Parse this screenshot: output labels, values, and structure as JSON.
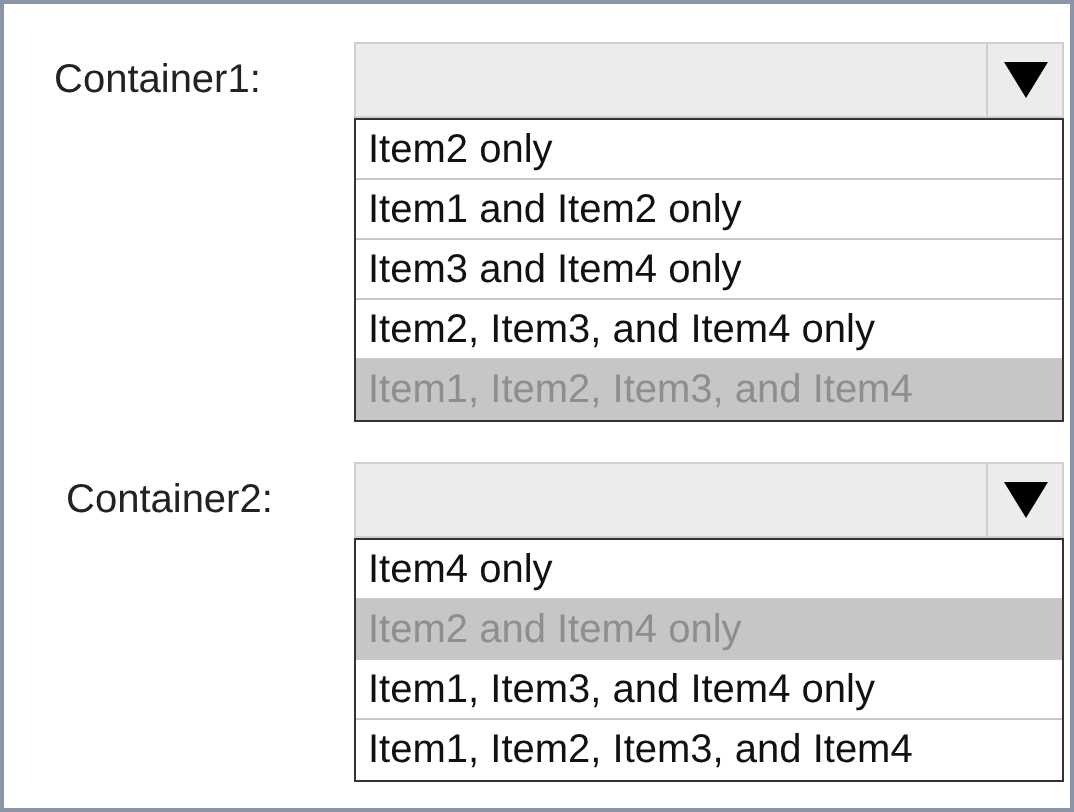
{
  "containers": [
    {
      "label": "Container1:",
      "options": [
        {
          "text": "Item2 only",
          "selected": false
        },
        {
          "text": "Item1 and Item2 only",
          "selected": false
        },
        {
          "text": "Item3 and Item4 only",
          "selected": false
        },
        {
          "text": "Item2, Item3, and Item4 only",
          "selected": false
        },
        {
          "text": "Item1, Item2, Item3, and Item4",
          "selected": true
        }
      ]
    },
    {
      "label": "Container2:",
      "options": [
        {
          "text": "Item4 only",
          "selected": false
        },
        {
          "text": "Item2 and Item4 only",
          "selected": true
        },
        {
          "text": "Item1, Item3, and Item4 only",
          "selected": false
        },
        {
          "text": "Item1, Item2, Item3, and Item4",
          "selected": false
        }
      ]
    }
  ]
}
